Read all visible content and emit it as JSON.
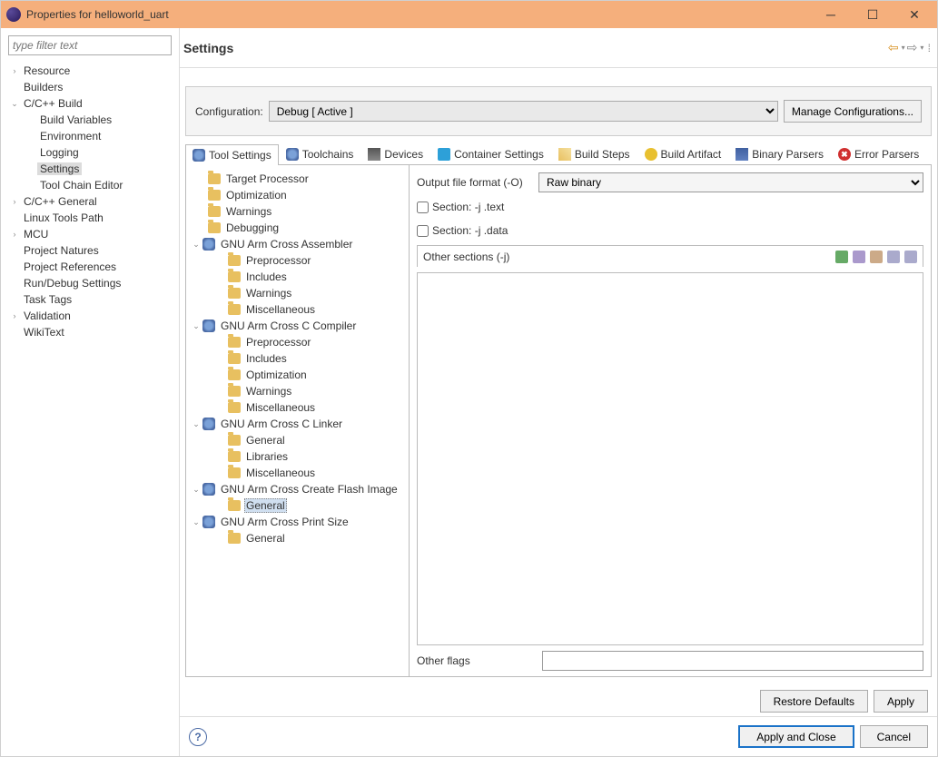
{
  "window": {
    "title": "Properties for helloworld_uart"
  },
  "filter": {
    "placeholder": "type filter text"
  },
  "nav": {
    "items": [
      {
        "label": "Resource",
        "indent": 0,
        "arrow": "›"
      },
      {
        "label": "Builders",
        "indent": 0,
        "arrow": ""
      },
      {
        "label": "C/C++ Build",
        "indent": 0,
        "arrow": "⌄"
      },
      {
        "label": "Build Variables",
        "indent": 1,
        "arrow": ""
      },
      {
        "label": "Environment",
        "indent": 1,
        "arrow": ""
      },
      {
        "label": "Logging",
        "indent": 1,
        "arrow": ""
      },
      {
        "label": "Settings",
        "indent": 1,
        "arrow": "",
        "selected": true
      },
      {
        "label": "Tool Chain Editor",
        "indent": 1,
        "arrow": ""
      },
      {
        "label": "C/C++ General",
        "indent": 0,
        "arrow": "›"
      },
      {
        "label": "Linux Tools Path",
        "indent": 0,
        "arrow": ""
      },
      {
        "label": "MCU",
        "indent": 0,
        "arrow": "›"
      },
      {
        "label": "Project Natures",
        "indent": 0,
        "arrow": ""
      },
      {
        "label": "Project References",
        "indent": 0,
        "arrow": ""
      },
      {
        "label": "Run/Debug Settings",
        "indent": 0,
        "arrow": ""
      },
      {
        "label": "Task Tags",
        "indent": 0,
        "arrow": ""
      },
      {
        "label": "Validation",
        "indent": 0,
        "arrow": "›"
      },
      {
        "label": "WikiText",
        "indent": 0,
        "arrow": ""
      }
    ]
  },
  "page": {
    "title": "Settings",
    "config_label": "Configuration:",
    "config_value": "Debug  [ Active ]",
    "manage_btn": "Manage Configurations..."
  },
  "tabs": [
    {
      "label": "Tool Settings",
      "icon": "ic-tool",
      "active": true
    },
    {
      "label": "Toolchains",
      "icon": "ic-tool"
    },
    {
      "label": "Devices",
      "icon": "ic-dev"
    },
    {
      "label": "Container Settings",
      "icon": "ic-cont"
    },
    {
      "label": "Build Steps",
      "icon": "ic-steps"
    },
    {
      "label": "Build Artifact",
      "icon": "ic-art"
    },
    {
      "label": "Binary Parsers",
      "icon": "ic-bin"
    },
    {
      "label": "Error Parsers",
      "icon": "ic-err",
      "icontxt": "✖"
    }
  ],
  "tool_tree": [
    {
      "type": "leaf",
      "indent": 0,
      "icon": "folder",
      "label": "Target Processor"
    },
    {
      "type": "leaf",
      "indent": 0,
      "icon": "folder",
      "label": "Optimization"
    },
    {
      "type": "leaf",
      "indent": 0,
      "icon": "folder",
      "label": "Warnings"
    },
    {
      "type": "leaf",
      "indent": 0,
      "icon": "folder",
      "label": "Debugging"
    },
    {
      "type": "group",
      "indent": 1,
      "arrow": "⌄",
      "icon": "tool",
      "label": "GNU Arm Cross Assembler"
    },
    {
      "type": "leaf",
      "indent": 2,
      "icon": "folder",
      "label": "Preprocessor"
    },
    {
      "type": "leaf",
      "indent": 2,
      "icon": "folder",
      "label": "Includes"
    },
    {
      "type": "leaf",
      "indent": 2,
      "icon": "folder",
      "label": "Warnings"
    },
    {
      "type": "leaf",
      "indent": 2,
      "icon": "folder",
      "label": "Miscellaneous"
    },
    {
      "type": "group",
      "indent": 1,
      "arrow": "⌄",
      "icon": "tool",
      "label": "GNU Arm Cross C Compiler"
    },
    {
      "type": "leaf",
      "indent": 2,
      "icon": "folder",
      "label": "Preprocessor"
    },
    {
      "type": "leaf",
      "indent": 2,
      "icon": "folder",
      "label": "Includes"
    },
    {
      "type": "leaf",
      "indent": 2,
      "icon": "folder",
      "label": "Optimization"
    },
    {
      "type": "leaf",
      "indent": 2,
      "icon": "folder",
      "label": "Warnings"
    },
    {
      "type": "leaf",
      "indent": 2,
      "icon": "folder",
      "label": "Miscellaneous"
    },
    {
      "type": "group",
      "indent": 1,
      "arrow": "⌄",
      "icon": "tool",
      "label": "GNU Arm Cross C Linker"
    },
    {
      "type": "leaf",
      "indent": 2,
      "icon": "folder",
      "label": "General"
    },
    {
      "type": "leaf",
      "indent": 2,
      "icon": "folder",
      "label": "Libraries"
    },
    {
      "type": "leaf",
      "indent": 2,
      "icon": "folder",
      "label": "Miscellaneous"
    },
    {
      "type": "group",
      "indent": 1,
      "arrow": "⌄",
      "icon": "tool",
      "label": "GNU Arm Cross Create Flash Image"
    },
    {
      "type": "leaf",
      "indent": 2,
      "icon": "folder",
      "label": "General",
      "selected": true
    },
    {
      "type": "group",
      "indent": 1,
      "arrow": "⌄",
      "icon": "tool",
      "label": "GNU Arm Cross Print Size"
    },
    {
      "type": "leaf",
      "indent": 2,
      "icon": "folder",
      "label": "General"
    }
  ],
  "form": {
    "output_label": "Output file format (-O)",
    "output_value": "Raw binary",
    "chk_text": "Section: -j .text",
    "chk_data": "Section: -j .data",
    "sections_label": "Other sections (-j)",
    "otherflags_label": "Other flags",
    "otherflags_value": ""
  },
  "buttons": {
    "restore": "Restore Defaults",
    "apply": "Apply",
    "apply_close": "Apply and Close",
    "cancel": "Cancel"
  }
}
